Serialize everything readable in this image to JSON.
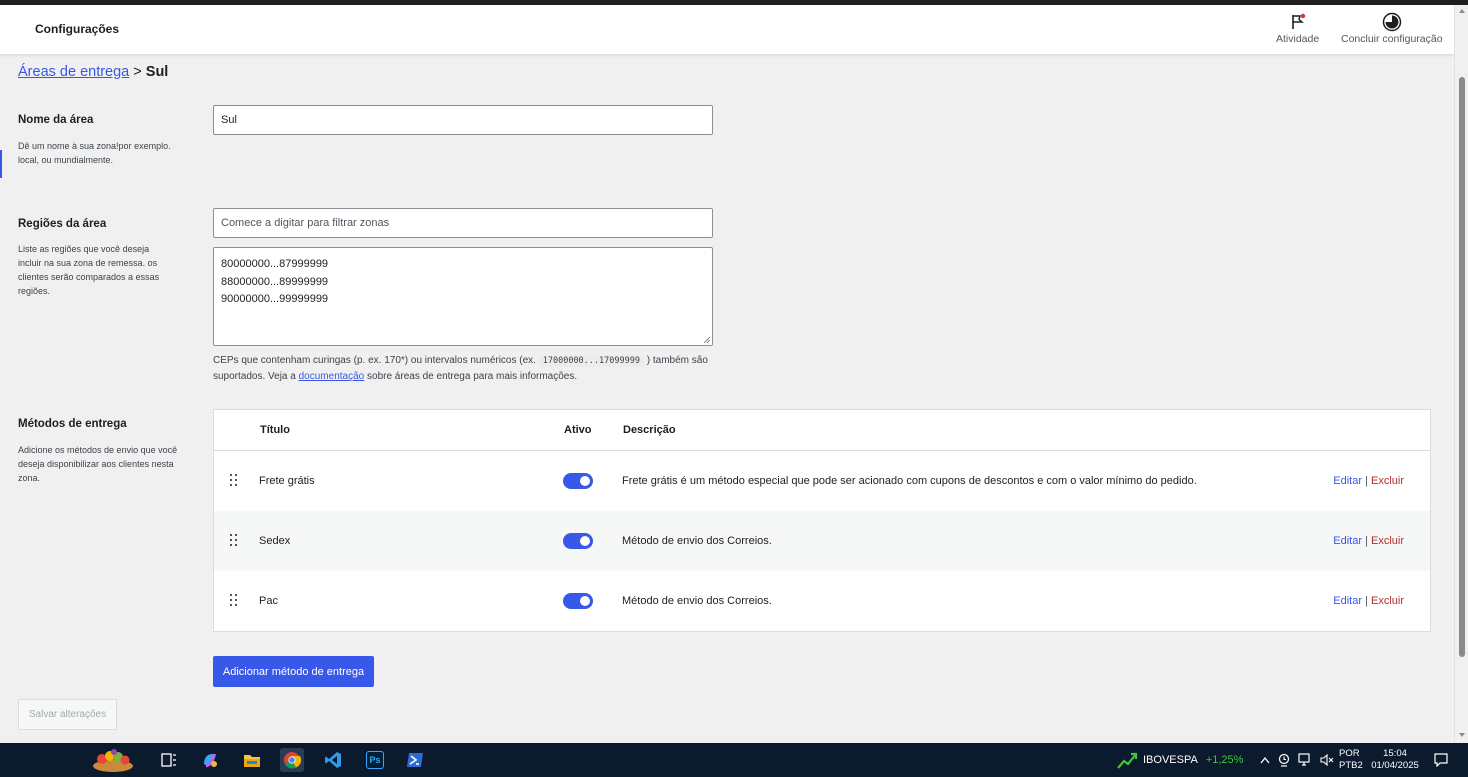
{
  "header": {
    "title": "Configurações",
    "activity_label": "Atividade",
    "finish_label": "Concluir configuração"
  },
  "breadcrumb": {
    "parent": "Áreas de entrega",
    "separator": ">",
    "current": "Sul"
  },
  "zone_name": {
    "title": "Nome da área",
    "description": "Dê um nome à sua zona!por exemplo. local, ou mundialmente.",
    "value": "Sul"
  },
  "zone_regions": {
    "title": "Regiões da área",
    "description": "Liste as regiões que você deseja incluir na sua zona de remessa. os clientes serão comparados a essas regiões.",
    "filter_placeholder": "Comece a digitar para filtrar zonas",
    "postcodes": [
      "80000000...87999999",
      "88000000...89999999",
      "90000000...99999999"
    ],
    "help_prefix": "CEPs que contenham curingas (p. ex. 170*) ou intervalos numéricos (ex.",
    "help_code": "17000000...17099999",
    "help_middle": ") também são suportados. Veja a",
    "help_link": "documentação",
    "help_suffix": "sobre áreas de entrega para mais informações."
  },
  "shipping_methods": {
    "title": "Métodos de entrega",
    "description": "Adicione os métodos de envio que você deseja disponibilizar aos clientes nesta zona.",
    "columns": {
      "title": "Título",
      "enabled": "Ativo",
      "description": "Descrição"
    },
    "rows": [
      {
        "title": "Frete grátis",
        "enabled": true,
        "description": "Frete grátis é um método especial que pode ser acionado com cupons de descontos e com o valor mínimo do pedido.",
        "edit": "Editar",
        "sep": "|",
        "delete": "Excluir"
      },
      {
        "title": "Sedex",
        "enabled": true,
        "description": "Método de envio dos Correios.",
        "edit": "Editar",
        "sep": "|",
        "delete": "Excluir"
      },
      {
        "title": "Pac",
        "enabled": true,
        "description": "Método de envio dos Correios.",
        "edit": "Editar",
        "sep": "|",
        "delete": "Excluir"
      }
    ],
    "add_button": "Adicionar método de entrega"
  },
  "save_button": "Salvar alterações",
  "taskbar": {
    "stock_name": "IBOVESPA",
    "stock_change": "+1,25%",
    "language": "POR",
    "keyboard": "PTB2",
    "time": "15:04",
    "date": "01/04/2025",
    "ps_label": "Ps"
  },
  "colors": {
    "accent": "#3858e9",
    "delete": "#b32d2e",
    "stock_positive": "#3ec63e",
    "taskbar_bg": "#0c1a2e"
  }
}
